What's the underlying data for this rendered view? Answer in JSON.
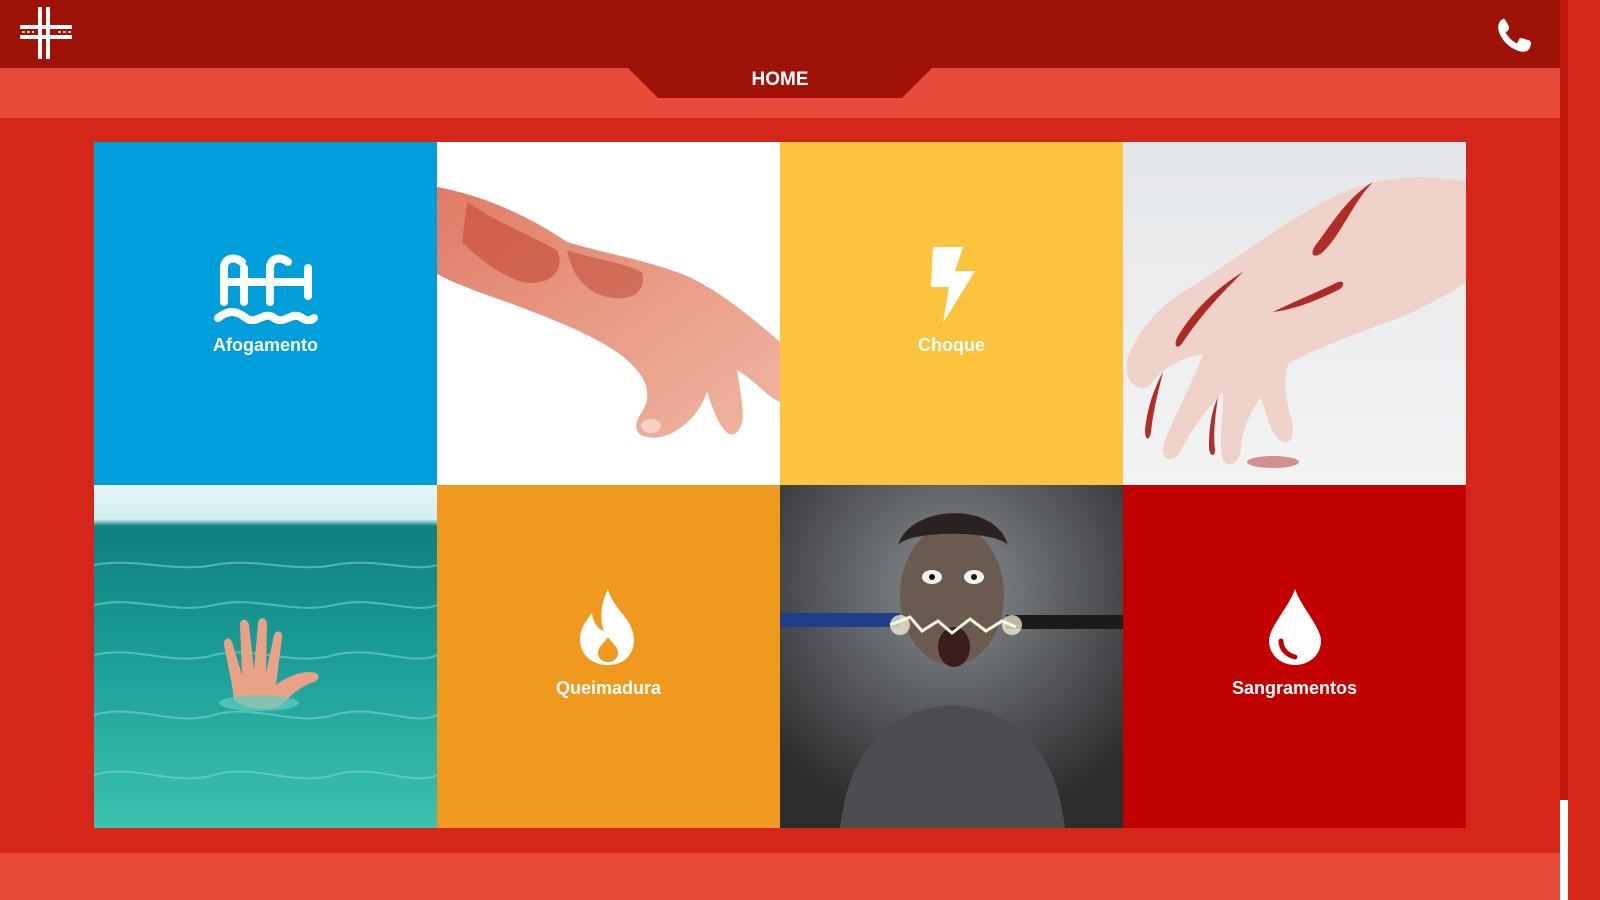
{
  "header": {
    "logo_icon": "hospital-cross-logo-icon",
    "phone_icon": "phone-icon",
    "bar_color": "#9e1208"
  },
  "nav": {
    "active_tab": "HOME",
    "band_color": "#e84a3a"
  },
  "tiles": [
    {
      "label": "Afogamento",
      "icon": "pool-ladder-icon",
      "color": "#009fdb"
    },
    {
      "photo": "burned-hand-photo"
    },
    {
      "label": "Choque",
      "icon": "lightning-bolt-icon",
      "color": "#fcc33e"
    },
    {
      "photo": "bleeding-hand-photo"
    },
    {
      "photo": "drowning-hand-photo"
    },
    {
      "label": "Queimadura",
      "icon": "flame-icon",
      "color": "#f0991f"
    },
    {
      "photo": "electric-shock-man-photo"
    },
    {
      "label": "Sangramentos",
      "icon": "blood-drop-icon",
      "color": "#c10000"
    }
  ],
  "page_background": "#d4271a"
}
